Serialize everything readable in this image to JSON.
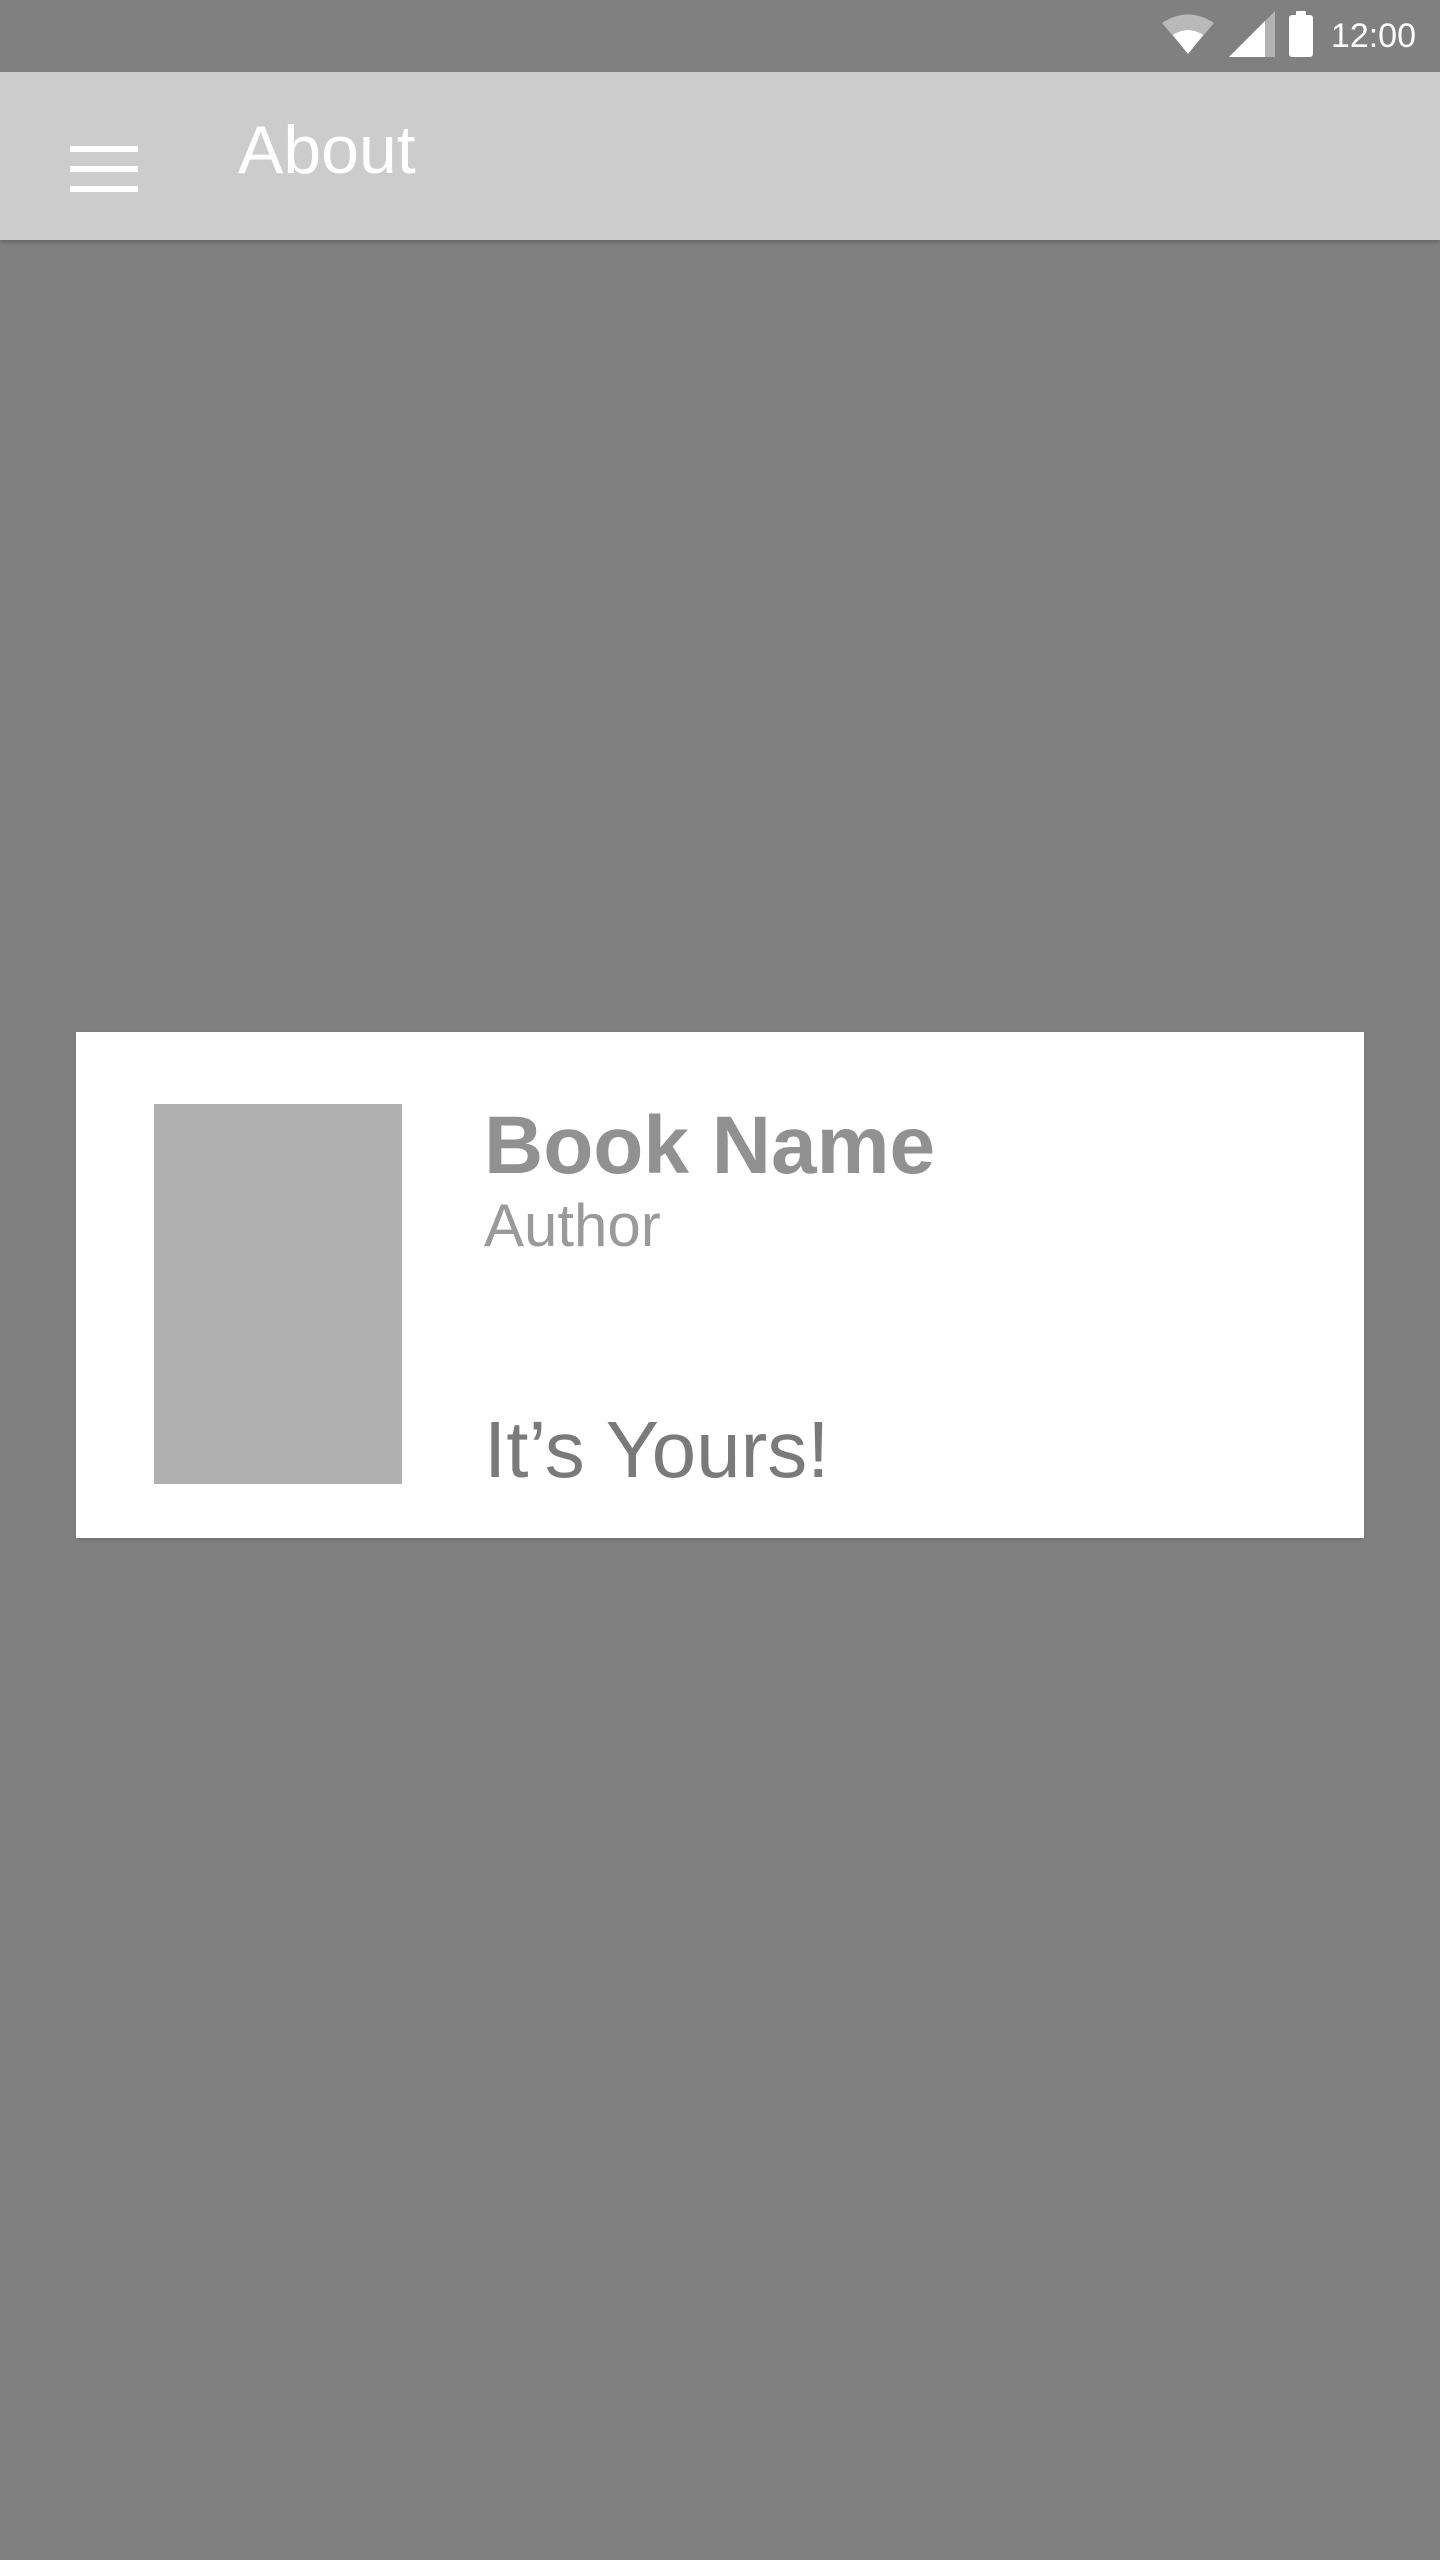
{
  "status_bar": {
    "time": "12:00",
    "icons": [
      "wifi-icon",
      "cellular-signal-icon",
      "battery-icon"
    ]
  },
  "app_bar": {
    "title": "About",
    "menu_icon": "hamburger-menu-icon"
  },
  "book_card": {
    "title": "Book Name",
    "author": "Author",
    "status": "It’s Yours!"
  },
  "colors": {
    "background": "#808080",
    "app_bar": "#cccccc",
    "card": "#ffffff",
    "cover_placeholder": "#b0b0b0",
    "title_text": "#919191",
    "author_text": "#9a9a9a",
    "status_text": "#7a7a7a"
  }
}
